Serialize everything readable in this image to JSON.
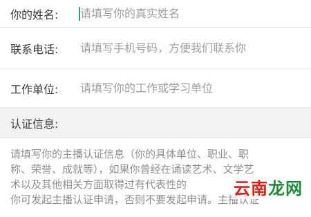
{
  "form": {
    "name": {
      "label": "你的姓名:",
      "placeholder": "请填写你的真实姓名",
      "value": ""
    },
    "phone": {
      "label": "联系电话:",
      "placeholder": "请填写手机号码，方便我们联系你",
      "value": ""
    },
    "work": {
      "label": "工作单位:",
      "placeholder": "请填写你的工作或学习单位",
      "value": ""
    }
  },
  "certification": {
    "header": "认证信息:",
    "description_lines": [
      "请填写你的主播认证信息（你的具体单位、职业、职",
      "称、荣誉、成就等），如果你曾经在诵读艺术、文学艺",
      "术以及其他相关方面取得过有代表性的",
      "你可发起主播认证申请，否则不要发起申请。主播认证"
    ]
  },
  "watermark": {
    "part1": "云南",
    "part2": "龙网"
  },
  "colors": {
    "cursor": "#1aa89a",
    "section_bg": "#f2f2f2",
    "watermark_red": "#d7211a",
    "watermark_green": "#1f8a3a"
  }
}
